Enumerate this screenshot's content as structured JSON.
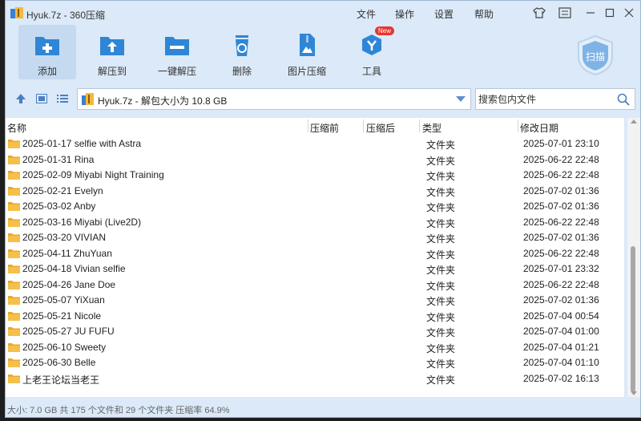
{
  "window": {
    "title": "Hyuk.7z - 360压缩",
    "menu": [
      "文件",
      "操作",
      "设置",
      "帮助"
    ]
  },
  "toolbar": {
    "items": [
      {
        "label": "添加",
        "icon": "add-folder-icon",
        "active": true
      },
      {
        "label": "解压到",
        "icon": "extract-to-icon"
      },
      {
        "label": "一键解压",
        "icon": "one-click-extract-icon"
      },
      {
        "label": "删除",
        "icon": "recycle-bin-icon"
      },
      {
        "label": "图片压缩",
        "icon": "image-compress-icon"
      },
      {
        "label": "工具",
        "icon": "tools-icon",
        "badge": "New"
      }
    ],
    "scan_label": "扫描"
  },
  "address": {
    "path": "Hyuk.7z - 解包大小为 10.8 GB",
    "search_placeholder": "搜索包内文件"
  },
  "list": {
    "columns": [
      "名称",
      "压缩前",
      "压缩后",
      "类型",
      "修改日期"
    ],
    "rows": [
      {
        "name": "2025-01-17 selfie with Astra",
        "type": "文件夹",
        "date": "2025-07-01 23:10"
      },
      {
        "name": "2025-01-31 Rina",
        "type": "文件夹",
        "date": "2025-06-22 22:48"
      },
      {
        "name": "2025-02-09 Miyabi Night Training",
        "type": "文件夹",
        "date": "2025-06-22 22:48"
      },
      {
        "name": "2025-02-21 Evelyn",
        "type": "文件夹",
        "date": "2025-07-02 01:36"
      },
      {
        "name": "2025-03-02 Anby",
        "type": "文件夹",
        "date": "2025-07-02 01:36"
      },
      {
        "name": "2025-03-16 Miyabi (Live2D)",
        "type": "文件夹",
        "date": "2025-06-22 22:48"
      },
      {
        "name": "2025-03-20 VIVIAN",
        "type": "文件夹",
        "date": "2025-07-02 01:36"
      },
      {
        "name": "2025-04-11 ZhuYuan",
        "type": "文件夹",
        "date": "2025-06-22 22:48"
      },
      {
        "name": "2025-04-18 Vivian selfie",
        "type": "文件夹",
        "date": "2025-07-01 23:32"
      },
      {
        "name": "2025-04-26 Jane Doe",
        "type": "文件夹",
        "date": "2025-06-22 22:48"
      },
      {
        "name": "2025-05-07 YiXuan",
        "type": "文件夹",
        "date": "2025-07-02 01:36"
      },
      {
        "name": "2025-05-21 Nicole",
        "type": "文件夹",
        "date": "2025-07-04 00:54"
      },
      {
        "name": "2025-05-27 JU FUFU",
        "type": "文件夹",
        "date": "2025-07-04 01:00"
      },
      {
        "name": "2025-06-10 Sweety",
        "type": "文件夹",
        "date": "2025-07-04 01:21"
      },
      {
        "name": "2025-06-30 Belle",
        "type": "文件夹",
        "date": "2025-07-04 01:10"
      },
      {
        "name": "上老王论坛当老王",
        "type": "文件夹",
        "date": "2025-07-02 16:13"
      }
    ]
  },
  "status": {
    "text": "大小: 7.0 GB 共 175 个文件和 29 个文件夹 压缩率 64.9%"
  },
  "colors": {
    "chrome": "#dbe9f8",
    "accent": "#2f86d6",
    "folder": "#f5c04a",
    "badge": "#e8342f"
  }
}
